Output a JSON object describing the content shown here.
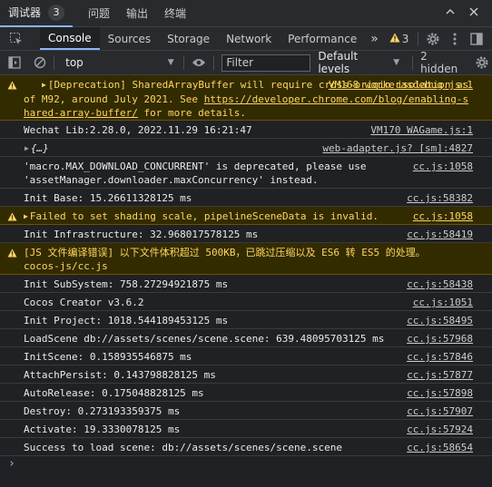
{
  "panel_tabs": [
    {
      "label": "调试器",
      "badge": "3"
    },
    {
      "label": "问题"
    },
    {
      "label": "输出"
    },
    {
      "label": "终端"
    }
  ],
  "toolbar": {
    "tabs": [
      "Console",
      "Sources",
      "Storage",
      "Network",
      "Performance"
    ],
    "more": "»",
    "warning_count": "3"
  },
  "filterbar": {
    "context": "top",
    "filter_placeholder": "Filter",
    "levels": "Default levels",
    "hidden": "2 hidden"
  },
  "messages": [
    {
      "type": "warn",
      "expandable": true,
      "text_a": "[Deprecation] SharedArrayBuffer will require cross-origin isolation as of M92, around July 2021. See ",
      "link": "https://developer.chrome.com/blog/enabling-shared-array-buffer/",
      "text_b": " for more details.",
      "source": "VM168 workerasdebug.js:1"
    },
    {
      "type": "log",
      "text": "Wechat Lib:2.28.0, 2022.11.29 16:21:47",
      "source": "VM170 WAGame.js:1"
    },
    {
      "type": "log",
      "expandable": true,
      "object": true,
      "text": "{…}",
      "source": "web-adapter.js? [sm]:4827"
    },
    {
      "type": "log",
      "text": "'macro.MAX_DOWNLOAD_CONCURRENT' is deprecated, please use\n'assetManager.downloader.maxConcurrency' instead.",
      "source": "cc.js:1058"
    },
    {
      "type": "log",
      "text": "Init Base: 15.26611328125 ms",
      "source": "cc.js:58382"
    },
    {
      "type": "warn",
      "expandable": true,
      "text": "Failed to set shading scale, pipelineSceneData is invalid.",
      "source": "cc.js:1058"
    },
    {
      "type": "log",
      "text": "Init Infrastructure: 32.968017578125 ms",
      "source": "cc.js:58419"
    },
    {
      "type": "warn",
      "text": "[JS 文件编译错误] 以下文件体积超过 500KB，已跳过压缩以及 ES6 转 ES5 的处理。\ncocos-js/cc.js"
    },
    {
      "type": "log",
      "text": "Init SubSystem: 758.27294921875 ms",
      "source": "cc.js:58438"
    },
    {
      "type": "log",
      "text": "Cocos Creator v3.6.2",
      "source": "cc.js:1051"
    },
    {
      "type": "log",
      "text": "Init Project: 1018.544189453125 ms",
      "source": "cc.js:58495"
    },
    {
      "type": "log",
      "text": "LoadScene db://assets/scenes/scene.scene: 639.48095703125 ms",
      "source": "cc.js:57968"
    },
    {
      "type": "log",
      "text": "InitScene: 0.158935546875 ms",
      "source": "cc.js:57846"
    },
    {
      "type": "log",
      "text": "AttachPersist: 0.143798828125 ms",
      "source": "cc.js:57877"
    },
    {
      "type": "log",
      "text": "AutoRelease: 0.175048828125 ms",
      "source": "cc.js:57898"
    },
    {
      "type": "log",
      "text": "Destroy: 0.273193359375 ms",
      "source": "cc.js:57907"
    },
    {
      "type": "log",
      "text": "Activate: 19.3330078125 ms",
      "source": "cc.js:57924"
    },
    {
      "type": "log",
      "text": "Success to load scene: db://assets/scenes/scene.scene",
      "source": "cc.js:58654"
    }
  ],
  "prompt": "›",
  "colors": {
    "background": "#202124",
    "toolbar": "#292a2d",
    "warning_bg": "#332b00",
    "warning_text": "#fdd663",
    "accent": "#8ab4f8"
  }
}
